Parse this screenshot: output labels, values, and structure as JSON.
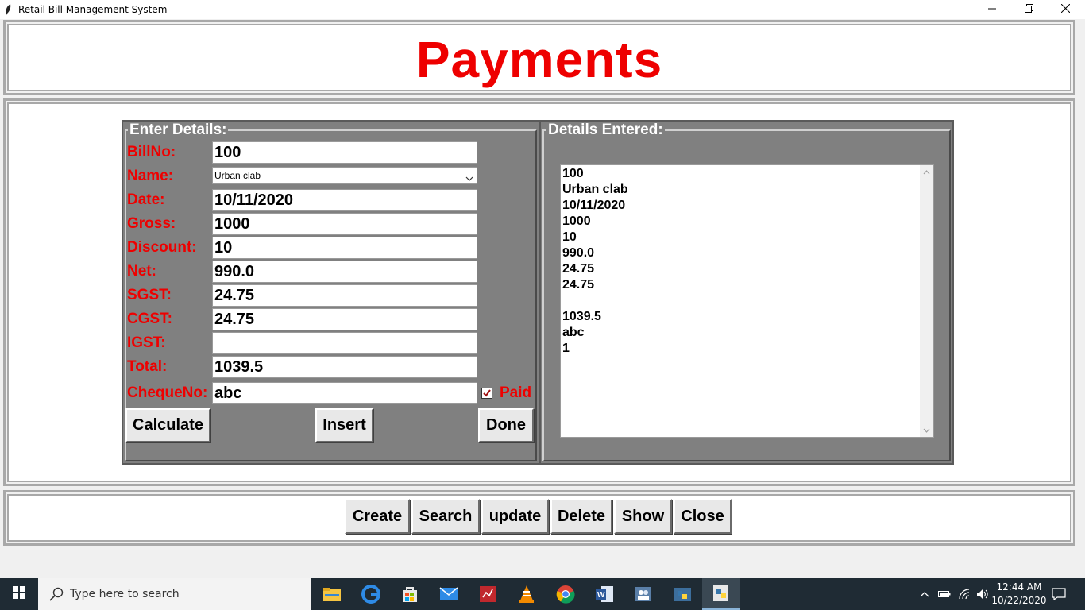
{
  "window": {
    "title": "Retail Bill Management System",
    "controls": [
      "minimize-icon",
      "restore-icon",
      "close-icon"
    ]
  },
  "header": {
    "title": "Payments"
  },
  "form": {
    "legend": "Enter Details:",
    "labels": {
      "billno": "BillNo:",
      "name": "Name:",
      "date": "Date:",
      "gross": "Gross:",
      "discount": "Discount:",
      "net": "Net:",
      "sgst": "SGST:",
      "cgst": "CGST:",
      "igst": "IGST:",
      "total": "Total:",
      "chequeno": "ChequeNo:"
    },
    "values": {
      "billno": "100",
      "name": "Urban clab",
      "date": "10/11/2020",
      "gross": "1000",
      "discount": "10",
      "net": "990.0",
      "sgst": "24.75",
      "cgst": "24.75",
      "igst": "",
      "total": "1039.5",
      "chequeno": "abc"
    },
    "paid": {
      "label": "Paid",
      "checked": true
    },
    "buttons": {
      "calculate": "Calculate",
      "insert": "Insert",
      "done": "Done"
    }
  },
  "details": {
    "legend": "Details Entered:",
    "lines": [
      "100",
      "Urban clab",
      "10/11/2020",
      "1000",
      "10",
      "990.0",
      "24.75",
      "24.75",
      "",
      "1039.5",
      "abc",
      "1"
    ]
  },
  "toolbar": {
    "create": "Create",
    "search": "Search",
    "update": "update",
    "delete": "Delete",
    "show": "Show",
    "close": "Close"
  },
  "taskbar": {
    "search_placeholder": "Type here to search",
    "apps": [
      "file-explorer-icon",
      "edge-icon",
      "store-icon",
      "mail-icon",
      "app-red-icon",
      "vlc-icon",
      "chrome-icon",
      "word-icon",
      "app-people-icon",
      "python-idle-icon",
      "python-active-icon"
    ],
    "time": "12:44 AM",
    "date": "10/22/2020"
  },
  "colors": {
    "accent_red": "#ee0000",
    "frame_gray": "#808080",
    "taskbar": "#1f2b34"
  }
}
